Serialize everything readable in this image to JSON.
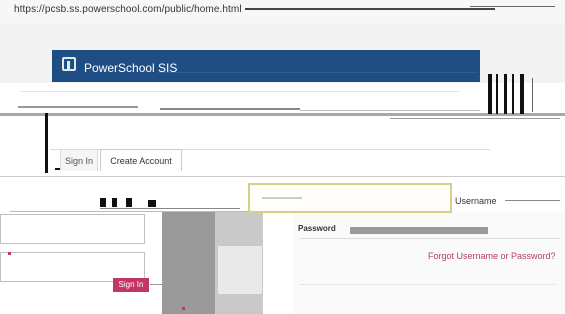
{
  "browser": {
    "url": "https://pcsb.ss.powerschool.com/public/home.html"
  },
  "header": {
    "title": "PowerSchool SIS"
  },
  "tabs": [
    {
      "label": "Sign In"
    },
    {
      "label": "Create Account"
    }
  ],
  "form": {
    "username_label": "Username",
    "password_label": "Password",
    "forgot_link": "Forgot Username or Password?",
    "signin_button": "Sign In"
  },
  "colors": {
    "header_bg": "#1f4e84",
    "accent": "#c23665"
  }
}
